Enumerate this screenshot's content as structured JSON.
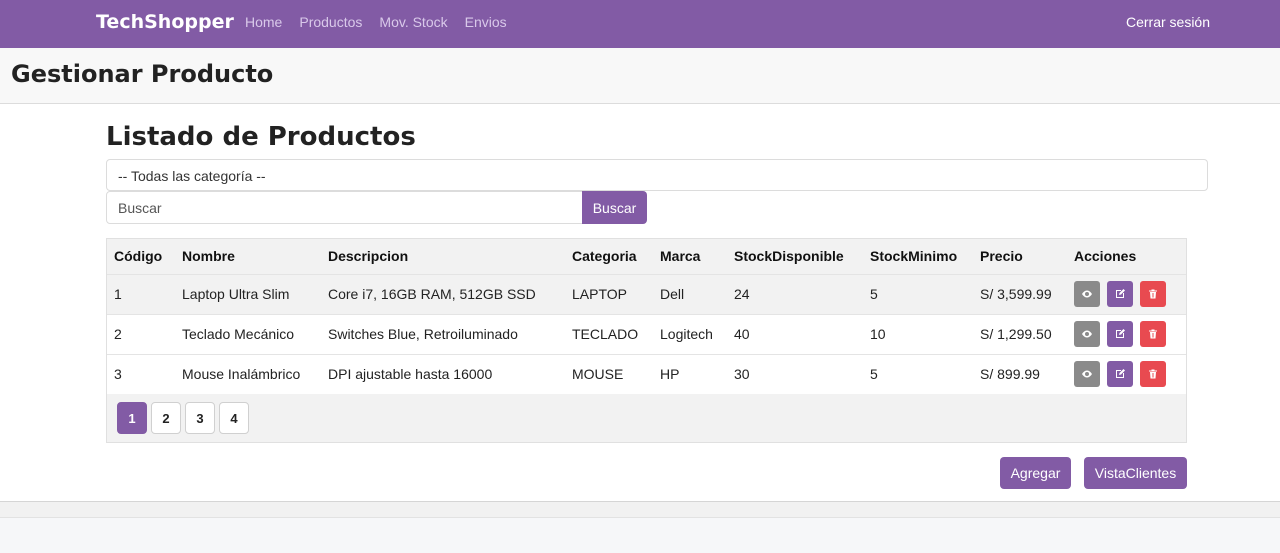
{
  "navbar": {
    "brand": "TechShopper",
    "links": [
      "Home",
      "Productos",
      "Mov. Stock",
      "Envios"
    ],
    "logout": "Cerrar sesión"
  },
  "page": {
    "title": "Gestionar Producto",
    "list_title": "Listado de Productos"
  },
  "filters": {
    "category_selected": "-- Todas las categoría --",
    "search_placeholder": "Buscar",
    "search_button": "Buscar"
  },
  "table": {
    "headers": [
      "Código",
      "Nombre",
      "Descripcion",
      "Categoria",
      "Marca",
      "StockDisponible",
      "StockMinimo",
      "Precio",
      "Acciones"
    ],
    "rows": [
      [
        "1",
        "Laptop Ultra Slim",
        "Core i7, 16GB RAM, 512GB SSD",
        "LAPTOP",
        "Dell",
        "24",
        "5",
        "S/ 3,599.99"
      ],
      [
        "2",
        "Teclado Mecánico",
        "Switches Blue, Retroiluminado",
        "TECLADO",
        "Logitech",
        "40",
        "10",
        "S/ 1,299.50"
      ],
      [
        "3",
        "Mouse Inalámbrico",
        "DPI ajustable hasta 16000",
        "MOUSE",
        "HP",
        "30",
        "5",
        "S/ 899.99"
      ]
    ],
    "action_icons": [
      "eye-icon",
      "edit-icon",
      "trash-icon"
    ]
  },
  "pagination": {
    "pages": [
      "1",
      "2",
      "3",
      "4"
    ],
    "current": "1"
  },
  "buttons": {
    "add": "Agregar",
    "clients_view": "VistaClientes"
  },
  "colors": {
    "accent": "#825ba5",
    "view": "#8a8a8a",
    "delete": "#e84a50"
  }
}
